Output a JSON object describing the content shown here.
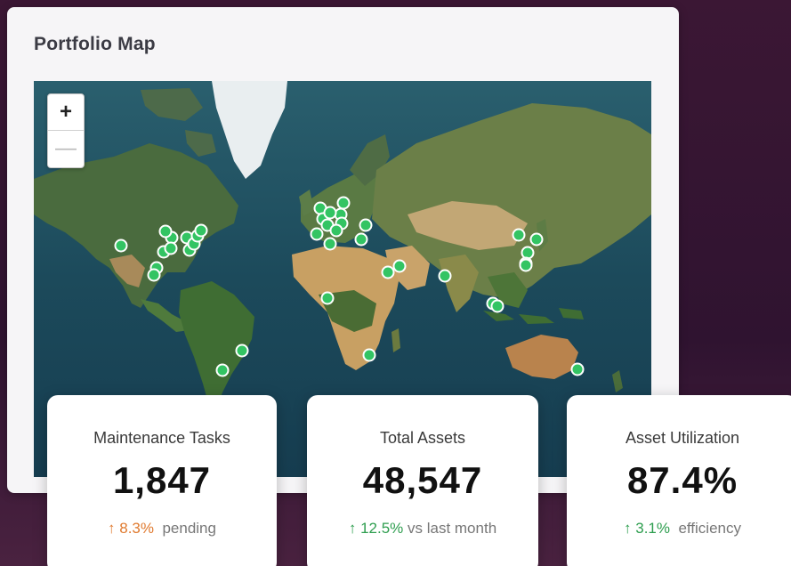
{
  "panel": {
    "title": "Portfolio Map"
  },
  "map": {
    "zoom_in_label": "+",
    "zoom_out_label": "—",
    "marker_color": "#33c463",
    "marker_count": 44
  },
  "cards": [
    {
      "label": "Maintenance Tasks",
      "value": "1,847",
      "arrow": "↑",
      "change": "8.3%",
      "suffix": "pending",
      "change_color": "#e07a2f"
    },
    {
      "label": "Total Assets",
      "value": "48,547",
      "arrow": "↑",
      "change": "12.5%",
      "suffix": "vs last month",
      "change_color": "#2e9e4f"
    },
    {
      "label": "Asset Utilization",
      "value": "87.4%",
      "arrow": "↑",
      "change": "3.1%",
      "suffix": "efficiency",
      "change_color": "#2e9e4f"
    }
  ]
}
